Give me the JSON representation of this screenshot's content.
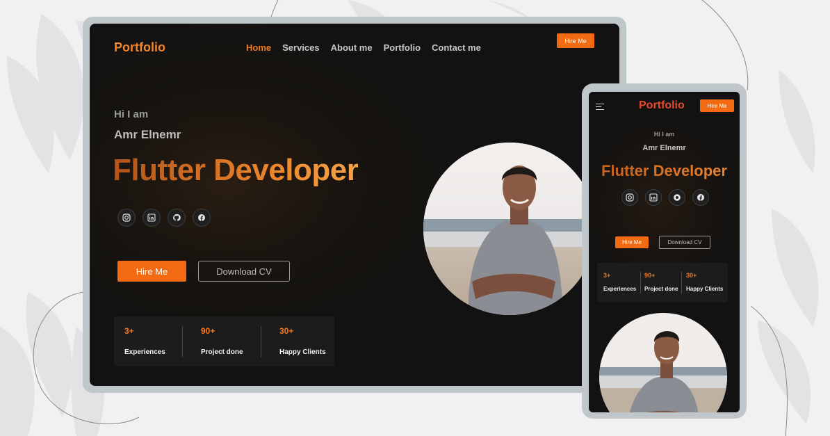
{
  "colors": {
    "accent": "#f26b13",
    "accent_text": "#f47a1f",
    "bg_dark": "#121212",
    "bg_page": "#f1f1f2",
    "frame": "#bfc7cb"
  },
  "desktop": {
    "logo": "Portfolio",
    "nav": [
      {
        "label": "Home",
        "active": true
      },
      {
        "label": "Services",
        "active": false
      },
      {
        "label": "About me",
        "active": false
      },
      {
        "label": "Portfolio",
        "active": false
      },
      {
        "label": "Contact me",
        "active": false
      }
    ],
    "hire_top": "Hire Me",
    "hero": {
      "greeting": "Hi I am",
      "name": "Amr Elnemr",
      "title": "Flutter Developer"
    },
    "socials": [
      "instagram-icon",
      "linkedin-icon",
      "github-icon",
      "facebook-icon"
    ],
    "buttons": {
      "hire": "Hire Me",
      "cv": "Download CV"
    },
    "stats": [
      {
        "value": "3+",
        "label": "Experiences"
      },
      {
        "value": "90+",
        "label": "Project done"
      },
      {
        "value": "30+",
        "label": "Happy Clients"
      }
    ]
  },
  "mobile": {
    "logo": "Portfolio",
    "hire_top": "Hire Me",
    "hero": {
      "greeting": "Hi I am",
      "name": "Amr Elnemr",
      "title": "Flutter Developer"
    },
    "buttons": {
      "hire": "Hire Me",
      "cv": "Download CV"
    },
    "stats": [
      {
        "value": "3+",
        "label": "Experiences"
      },
      {
        "value": "90+",
        "label": "Project done"
      },
      {
        "value": "30+",
        "label": "Happy Clients"
      }
    ]
  }
}
